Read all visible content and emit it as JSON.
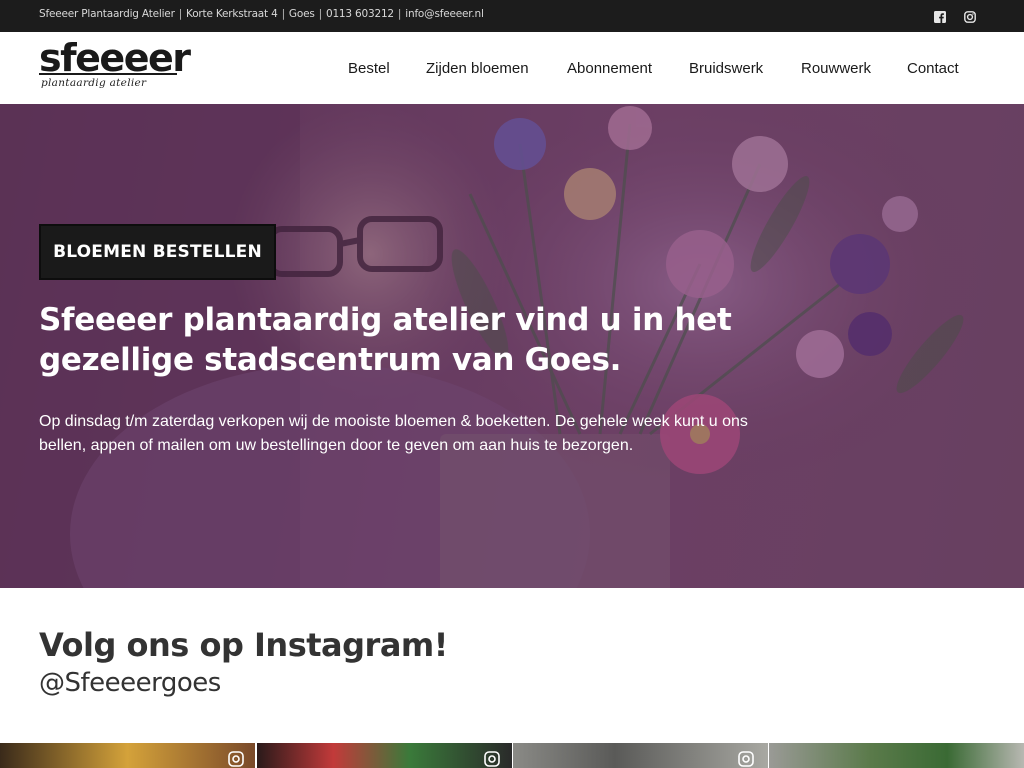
{
  "topbar": {
    "company": "Sfeeeer Plantaardig Atelier",
    "address": "Korte Kerkstraat 4",
    "city": "Goes",
    "phone": "0113 603212",
    "email": "info@sfeeeer.nl",
    "separator": "|",
    "social": [
      "facebook-icon",
      "instagram-icon"
    ]
  },
  "logo": {
    "word": "sfeeeer",
    "tagline": "plantaardig atelier"
  },
  "nav": {
    "items": [
      {
        "label": "Bestel"
      },
      {
        "label": "Zijden bloemen"
      },
      {
        "label": "Abonnement"
      },
      {
        "label": "Bruidswerk"
      },
      {
        "label": "Rouwwerk"
      },
      {
        "label": "Contact"
      }
    ]
  },
  "hero": {
    "button_label": "BLOEMEN BESTELLEN",
    "title": "Sfeeeer plantaardig atelier vind u in het gezellige stadscentrum van Goes.",
    "text": "Op dinsdag t/m zaterdag verkopen wij de mooiste bloemen & boeketten. De gehele week kunt u ons bellen, appen of mailen om uw bestellingen door te geven om aan huis te bezorgen."
  },
  "instagram": {
    "title": "Volg ons op Instagram!",
    "handle": "@Sfeeeergoes"
  },
  "colors": {
    "topbar_bg": "#1c1c1c",
    "hero_overlay": "#6b3f63",
    "button_bg": "#1a1a1a",
    "heading_text": "#333333"
  }
}
